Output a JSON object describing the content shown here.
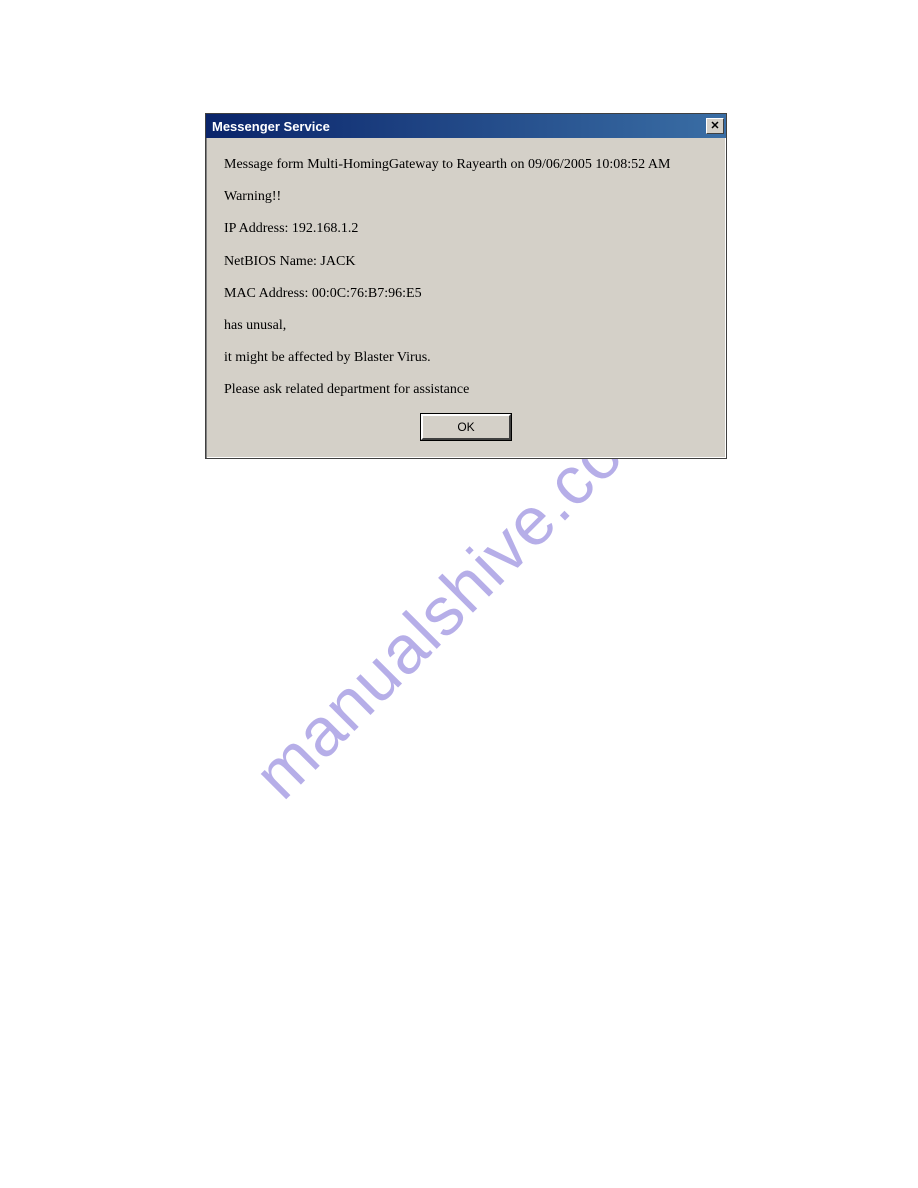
{
  "dialog": {
    "title": "Messenger Service",
    "close_glyph": "✕",
    "lines": {
      "l0": "Message form Multi-HomingGateway to Rayearth on 09/06/2005 10:08:52 AM",
      "l1": "Warning!!",
      "l2": "IP Address: 192.168.1.2",
      "l3": "NetBIOS Name: JACK",
      "l4": "MAC Address: 00:0C:76:B7:96:E5",
      "l5": "has unusal,",
      "l6": "it might be affected by Blaster Virus.",
      "l7": "Please ask related department for assistance"
    },
    "ok_label": "OK"
  },
  "watermark": "manualshive.com"
}
